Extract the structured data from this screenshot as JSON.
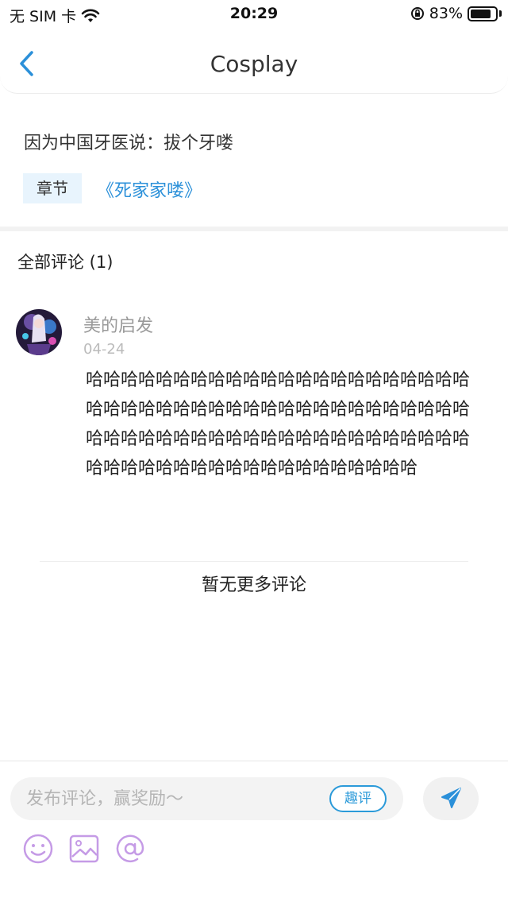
{
  "status_bar": {
    "carrier": "无 SIM 卡",
    "time": "20:29",
    "battery_percent": "83%",
    "battery_level": 0.83
  },
  "nav": {
    "title": "Cosplay",
    "back_icon": "chevron-left-icon"
  },
  "post": {
    "text": "因为中国牙医说：拔个牙喽",
    "chapter_tag": "章节",
    "chapter_link": "《死家家喽》"
  },
  "comments": {
    "header": "全部评论 (1)",
    "items": [
      {
        "author": "美的启发",
        "date": "04-24",
        "body": "哈哈哈哈哈哈哈哈哈哈哈哈哈哈哈哈哈哈哈哈哈哈哈哈哈哈哈哈哈哈哈哈哈哈哈哈哈哈哈哈哈哈哈哈哈哈哈哈哈哈哈哈哈哈哈哈哈哈哈哈哈哈哈哈哈哈哈哈哈哈哈哈哈哈哈哈哈哈哈哈哈哈哈哈哈"
      }
    ],
    "no_more": "暂无更多评论"
  },
  "composer": {
    "placeholder": "发布评论，赢奖励～",
    "quping_label": "趣评",
    "send_icon": "send-icon",
    "tools": [
      "emoji-icon",
      "image-icon",
      "at-icon"
    ]
  },
  "colors": {
    "accent": "#2b90d9",
    "tool_purple": "#c59be6",
    "tag_bg": "#e8f4fd"
  }
}
